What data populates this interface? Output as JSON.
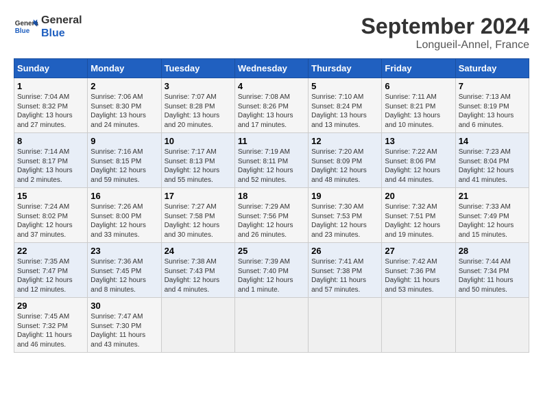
{
  "header": {
    "logo_line1": "General",
    "logo_line2": "Blue",
    "month": "September 2024",
    "location": "Longueil-Annel, France"
  },
  "weekdays": [
    "Sunday",
    "Monday",
    "Tuesday",
    "Wednesday",
    "Thursday",
    "Friday",
    "Saturday"
  ],
  "days": [
    {
      "num": "",
      "info": ""
    },
    {
      "num": "",
      "info": ""
    },
    {
      "num": "",
      "info": ""
    },
    {
      "num": "",
      "info": ""
    },
    {
      "num": "",
      "info": ""
    },
    {
      "num": "",
      "info": ""
    },
    {
      "num": "1",
      "info": "Sunrise: 7:04 AM\nSunset: 8:32 PM\nDaylight: 13 hours\nand 27 minutes."
    },
    {
      "num": "2",
      "info": "Sunrise: 7:06 AM\nSunset: 8:30 PM\nDaylight: 13 hours\nand 24 minutes."
    },
    {
      "num": "3",
      "info": "Sunrise: 7:07 AM\nSunset: 8:28 PM\nDaylight: 13 hours\nand 20 minutes."
    },
    {
      "num": "4",
      "info": "Sunrise: 7:08 AM\nSunset: 8:26 PM\nDaylight: 13 hours\nand 17 minutes."
    },
    {
      "num": "5",
      "info": "Sunrise: 7:10 AM\nSunset: 8:24 PM\nDaylight: 13 hours\nand 13 minutes."
    },
    {
      "num": "6",
      "info": "Sunrise: 7:11 AM\nSunset: 8:21 PM\nDaylight: 13 hours\nand 10 minutes."
    },
    {
      "num": "7",
      "info": "Sunrise: 7:13 AM\nSunset: 8:19 PM\nDaylight: 13 hours\nand 6 minutes."
    },
    {
      "num": "8",
      "info": "Sunrise: 7:14 AM\nSunset: 8:17 PM\nDaylight: 13 hours\nand 2 minutes."
    },
    {
      "num": "9",
      "info": "Sunrise: 7:16 AM\nSunset: 8:15 PM\nDaylight: 12 hours\nand 59 minutes."
    },
    {
      "num": "10",
      "info": "Sunrise: 7:17 AM\nSunset: 8:13 PM\nDaylight: 12 hours\nand 55 minutes."
    },
    {
      "num": "11",
      "info": "Sunrise: 7:19 AM\nSunset: 8:11 PM\nDaylight: 12 hours\nand 52 minutes."
    },
    {
      "num": "12",
      "info": "Sunrise: 7:20 AM\nSunset: 8:09 PM\nDaylight: 12 hours\nand 48 minutes."
    },
    {
      "num": "13",
      "info": "Sunrise: 7:22 AM\nSunset: 8:06 PM\nDaylight: 12 hours\nand 44 minutes."
    },
    {
      "num": "14",
      "info": "Sunrise: 7:23 AM\nSunset: 8:04 PM\nDaylight: 12 hours\nand 41 minutes."
    },
    {
      "num": "15",
      "info": "Sunrise: 7:24 AM\nSunset: 8:02 PM\nDaylight: 12 hours\nand 37 minutes."
    },
    {
      "num": "16",
      "info": "Sunrise: 7:26 AM\nSunset: 8:00 PM\nDaylight: 12 hours\nand 33 minutes."
    },
    {
      "num": "17",
      "info": "Sunrise: 7:27 AM\nSunset: 7:58 PM\nDaylight: 12 hours\nand 30 minutes."
    },
    {
      "num": "18",
      "info": "Sunrise: 7:29 AM\nSunset: 7:56 PM\nDaylight: 12 hours\nand 26 minutes."
    },
    {
      "num": "19",
      "info": "Sunrise: 7:30 AM\nSunset: 7:53 PM\nDaylight: 12 hours\nand 23 minutes."
    },
    {
      "num": "20",
      "info": "Sunrise: 7:32 AM\nSunset: 7:51 PM\nDaylight: 12 hours\nand 19 minutes."
    },
    {
      "num": "21",
      "info": "Sunrise: 7:33 AM\nSunset: 7:49 PM\nDaylight: 12 hours\nand 15 minutes."
    },
    {
      "num": "22",
      "info": "Sunrise: 7:35 AM\nSunset: 7:47 PM\nDaylight: 12 hours\nand 12 minutes."
    },
    {
      "num": "23",
      "info": "Sunrise: 7:36 AM\nSunset: 7:45 PM\nDaylight: 12 hours\nand 8 minutes."
    },
    {
      "num": "24",
      "info": "Sunrise: 7:38 AM\nSunset: 7:43 PM\nDaylight: 12 hours\nand 4 minutes."
    },
    {
      "num": "25",
      "info": "Sunrise: 7:39 AM\nSunset: 7:40 PM\nDaylight: 12 hours\nand 1 minute."
    },
    {
      "num": "26",
      "info": "Sunrise: 7:41 AM\nSunset: 7:38 PM\nDaylight: 11 hours\nand 57 minutes."
    },
    {
      "num": "27",
      "info": "Sunrise: 7:42 AM\nSunset: 7:36 PM\nDaylight: 11 hours\nand 53 minutes."
    },
    {
      "num": "28",
      "info": "Sunrise: 7:44 AM\nSunset: 7:34 PM\nDaylight: 11 hours\nand 50 minutes."
    },
    {
      "num": "29",
      "info": "Sunrise: 7:45 AM\nSunset: 7:32 PM\nDaylight: 11 hours\nand 46 minutes."
    },
    {
      "num": "30",
      "info": "Sunrise: 7:47 AM\nSunset: 7:30 PM\nDaylight: 11 hours\nand 43 minutes."
    },
    {
      "num": "",
      "info": ""
    },
    {
      "num": "",
      "info": ""
    },
    {
      "num": "",
      "info": ""
    },
    {
      "num": "",
      "info": ""
    },
    {
      "num": "",
      "info": ""
    }
  ]
}
